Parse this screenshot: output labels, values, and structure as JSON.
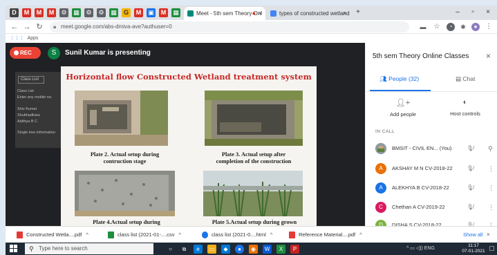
{
  "browser": {
    "tabs": [
      {
        "label": "Meet - 5th sem Theory Onl",
        "active": true
      },
      {
        "label": "types of constructed wetlands",
        "active": false
      }
    ],
    "url": "meet.google.com/abs-dmiva-ave?authuser=0",
    "bookmarks_label": "Apps",
    "new_tab": "+"
  },
  "meet": {
    "rec_label": "REC",
    "presenter_initial": "S",
    "presenter_text": "Sunil Kumar is presenting"
  },
  "sheet": {
    "title": "Class List",
    "rows": [
      "Class List",
      "Enter any mobile no.",
      "Shiv Kumar",
      "Shubhadkara",
      "Adithya B C",
      "Single tree information"
    ]
  },
  "slide": {
    "title": "Horizontal flow  Constructed Wetland treatment system",
    "captions": [
      [
        "Plate 2. Actual setup during",
        "contruction stage"
      ],
      [
        "Plate 3. Actual setup after",
        "completion of the construction"
      ],
      [
        "Plate 4.Actual setup during"
      ],
      [
        "Plate 5.Actual setup during grown"
      ]
    ]
  },
  "panel": {
    "title": "5th sem Theory Online Classes",
    "people_tab": "People (32)",
    "chat_tab": "Chat",
    "add_people": "Add people",
    "host_controls": "Host controls",
    "in_call": "IN CALL",
    "participants": [
      {
        "initial": "",
        "name": "BMSIT - CIVIL EN...  (You)",
        "color": "#7f8c8d"
      },
      {
        "initial": "A",
        "name": "AKSHAY M N CV-2018-22",
        "color": "#e8710a"
      },
      {
        "initial": "A",
        "name": "ALEKHYA B CV-2018-22",
        "color": "#1a73e8"
      },
      {
        "initial": "C",
        "name": "Chethan A CV-2019-22",
        "color": "#d81b60"
      },
      {
        "initial": "D",
        "name": "DISHA S CV-2018-22",
        "color": "#7cb342"
      }
    ]
  },
  "downloads": {
    "items": [
      {
        "label": "Constructed Wetla....pdf",
        "color": "#e53935"
      },
      {
        "label": "class list (2021-01-....csv",
        "color": "#1e8e3e"
      },
      {
        "label": "class list (2021-0....html",
        "color": "#1a73e8"
      },
      {
        "label": "Reference Material....pdf",
        "color": "#e53935"
      }
    ],
    "show_all": "Show all"
  },
  "taskbar": {
    "search_placeholder": "Type here to search",
    "tray_text": "ENG",
    "time": "11:17",
    "date": "07-01-2021"
  }
}
